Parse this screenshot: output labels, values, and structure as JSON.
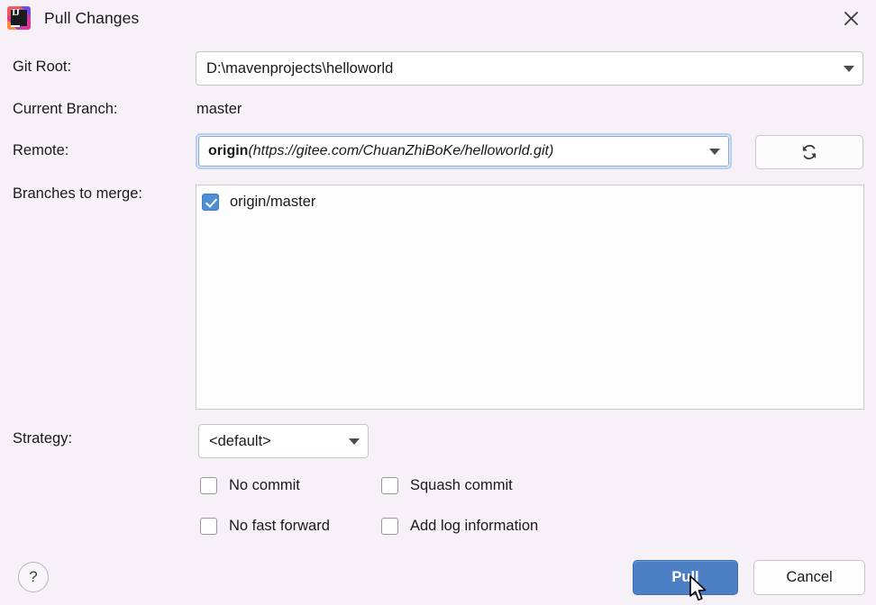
{
  "window": {
    "title": "Pull Changes",
    "app_icon": "intellij-idea-icon",
    "icon_letters": "IJ",
    "close_icon": "close-icon"
  },
  "form": {
    "git_root": {
      "label": "Git Root:",
      "value": "D:\\mavenprojects\\helloworld"
    },
    "current_branch": {
      "label": "Current Branch:",
      "value": "master"
    },
    "remote": {
      "label": "Remote:",
      "value_name": "origin",
      "value_url": "(https://gitee.com/ChuanZhiBoKe/helloworld.git)",
      "refresh_icon": "refresh-icon"
    },
    "branches_to_merge": {
      "label": "Branches to merge:",
      "items": [
        {
          "label": "origin/master",
          "checked": true
        }
      ]
    },
    "strategy": {
      "label": "Strategy:",
      "value": "<default>"
    },
    "options": [
      {
        "label": "No commit",
        "checked": false
      },
      {
        "label": "Squash commit",
        "checked": false
      },
      {
        "label": "No fast forward",
        "checked": false
      },
      {
        "label": "Add log information",
        "checked": false
      }
    ]
  },
  "footer": {
    "help_label": "?",
    "pull_label": "Pull",
    "cancel_label": "Cancel"
  },
  "colors": {
    "background": "#f6f1f7",
    "accent_blue": "#4c7fc4",
    "checkbox_blue": "#4f8ed4",
    "focus_ring": "#b6cdec",
    "field_white": "#ffffff",
    "border_gray": "#c9c4cb",
    "text": "#1a1a1a"
  }
}
